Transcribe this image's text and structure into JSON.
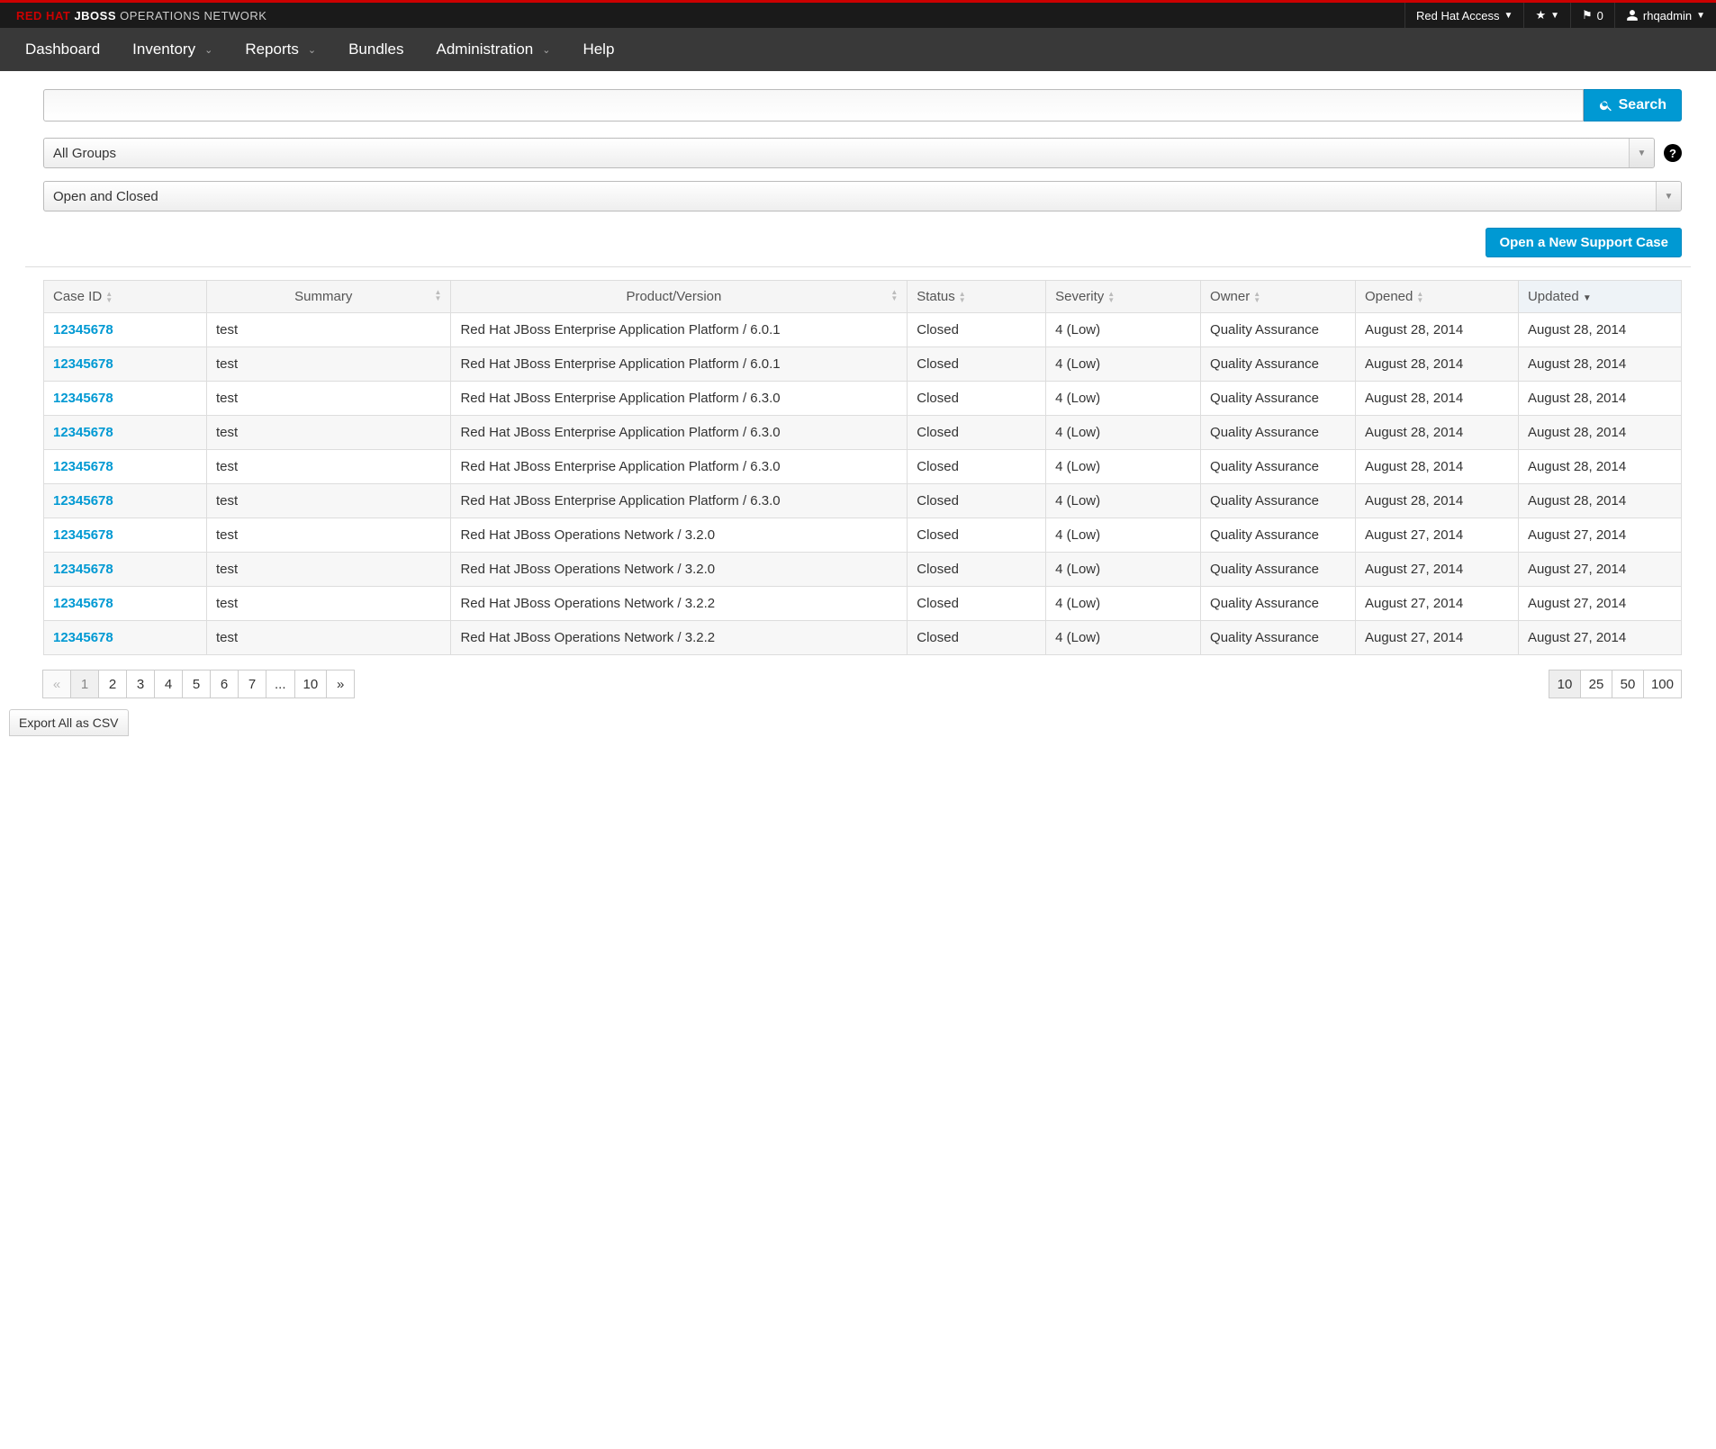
{
  "brand": {
    "part1": "RED HAT",
    "part2": "JBOSS",
    "part3": "OPERATIONS NETWORK"
  },
  "topbar": {
    "access": "Red Hat Access",
    "flag_count": "0",
    "user": "rhqadmin"
  },
  "nav": {
    "dashboard": "Dashboard",
    "inventory": "Inventory",
    "reports": "Reports",
    "bundles": "Bundles",
    "administration": "Administration",
    "help": "Help"
  },
  "search": {
    "button": "Search",
    "value": ""
  },
  "filters": {
    "groups": "All Groups",
    "status": "Open and Closed"
  },
  "actions": {
    "open_case": "Open a New Support Case",
    "export": "Export All as CSV"
  },
  "table": {
    "headers": {
      "case_id": "Case ID",
      "summary": "Summary",
      "product": "Product/Version",
      "status": "Status",
      "severity": "Severity",
      "owner": "Owner",
      "opened": "Opened",
      "updated": "Updated"
    },
    "rows": [
      {
        "id": "12345678",
        "summary": "test",
        "product": "Red Hat JBoss Enterprise Application Platform / 6.0.1",
        "status": "Closed",
        "severity": "4 (Low)",
        "owner": "Quality Assurance",
        "opened": "August 28, 2014",
        "updated": "August 28, 2014"
      },
      {
        "id": "12345678",
        "summary": "test",
        "product": "Red Hat JBoss Enterprise Application Platform / 6.0.1",
        "status": "Closed",
        "severity": "4 (Low)",
        "owner": "Quality Assurance",
        "opened": "August 28, 2014",
        "updated": "August 28, 2014"
      },
      {
        "id": "12345678",
        "summary": "test",
        "product": "Red Hat JBoss Enterprise Application Platform / 6.3.0",
        "status": "Closed",
        "severity": "4 (Low)",
        "owner": "Quality Assurance",
        "opened": "August 28, 2014",
        "updated": "August 28, 2014"
      },
      {
        "id": "12345678",
        "summary": "test",
        "product": "Red Hat JBoss Enterprise Application Platform / 6.3.0",
        "status": "Closed",
        "severity": "4 (Low)",
        "owner": "Quality Assurance",
        "opened": "August 28, 2014",
        "updated": "August 28, 2014"
      },
      {
        "id": "12345678",
        "summary": "test",
        "product": "Red Hat JBoss Enterprise Application Platform / 6.3.0",
        "status": "Closed",
        "severity": "4 (Low)",
        "owner": "Quality Assurance",
        "opened": "August 28, 2014",
        "updated": "August 28, 2014"
      },
      {
        "id": "12345678",
        "summary": "test",
        "product": "Red Hat JBoss Enterprise Application Platform / 6.3.0",
        "status": "Closed",
        "severity": "4 (Low)",
        "owner": "Quality Assurance",
        "opened": "August 28, 2014",
        "updated": "August 28, 2014"
      },
      {
        "id": "12345678",
        "summary": "test",
        "product": "Red Hat JBoss Operations Network / 3.2.0",
        "status": "Closed",
        "severity": "4 (Low)",
        "owner": "Quality Assurance",
        "opened": "August 27, 2014",
        "updated": "August 27, 2014"
      },
      {
        "id": "12345678",
        "summary": "test",
        "product": "Red Hat JBoss Operations Network / 3.2.0",
        "status": "Closed",
        "severity": "4 (Low)",
        "owner": "Quality Assurance",
        "opened": "August 27, 2014",
        "updated": "August 27, 2014"
      },
      {
        "id": "12345678",
        "summary": "test",
        "product": "Red Hat JBoss Operations Network / 3.2.2",
        "status": "Closed",
        "severity": "4 (Low)",
        "owner": "Quality Assurance",
        "opened": "August 27, 2014",
        "updated": "August 27, 2014"
      },
      {
        "id": "12345678",
        "summary": "test",
        "product": "Red Hat JBoss Operations Network / 3.2.2",
        "status": "Closed",
        "severity": "4 (Low)",
        "owner": "Quality Assurance",
        "opened": "August 27, 2014",
        "updated": "August 27, 2014"
      }
    ]
  },
  "pagination": {
    "pages": [
      "1",
      "2",
      "3",
      "4",
      "5",
      "6",
      "7",
      "...",
      "10"
    ],
    "active": "1",
    "sizes": [
      "10",
      "25",
      "50",
      "100"
    ],
    "active_size": "10"
  }
}
